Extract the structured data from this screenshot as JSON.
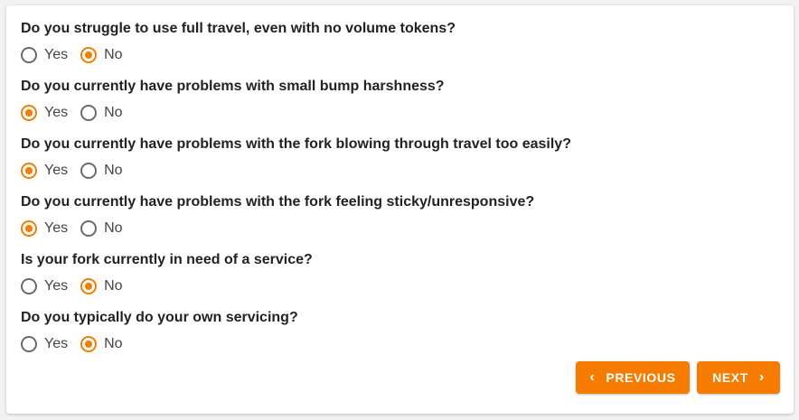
{
  "questions": [
    {
      "text": "Do you struggle to use full travel, even with no volume tokens?",
      "options": [
        {
          "label": "Yes",
          "selected": false
        },
        {
          "label": "No",
          "selected": true
        }
      ]
    },
    {
      "text": "Do you currently have problems with small bump harshness?",
      "options": [
        {
          "label": "Yes",
          "selected": true
        },
        {
          "label": "No",
          "selected": false
        }
      ]
    },
    {
      "text": "Do you currently have problems with the fork blowing through travel too easily?",
      "options": [
        {
          "label": "Yes",
          "selected": true
        },
        {
          "label": "No",
          "selected": false
        }
      ]
    },
    {
      "text": "Do you currently have problems with the fork feeling sticky/unresponsive?",
      "options": [
        {
          "label": "Yes",
          "selected": true
        },
        {
          "label": "No",
          "selected": false
        }
      ]
    },
    {
      "text": "Is your fork currently in need of a service?",
      "options": [
        {
          "label": "Yes",
          "selected": false
        },
        {
          "label": "No",
          "selected": true
        }
      ]
    },
    {
      "text": "Do you typically do your own servicing?",
      "options": [
        {
          "label": "Yes",
          "selected": false
        },
        {
          "label": "No",
          "selected": true
        }
      ]
    }
  ],
  "buttons": {
    "previous_label": "PREVIOUS",
    "next_label": "NEXT",
    "previous_icon": "chevron-left-icon",
    "next_icon": "chevron-right-icon"
  },
  "colors": {
    "accent": "#f57c00",
    "radio_unselected": "#6b6b6b",
    "question_text": "#222222"
  }
}
